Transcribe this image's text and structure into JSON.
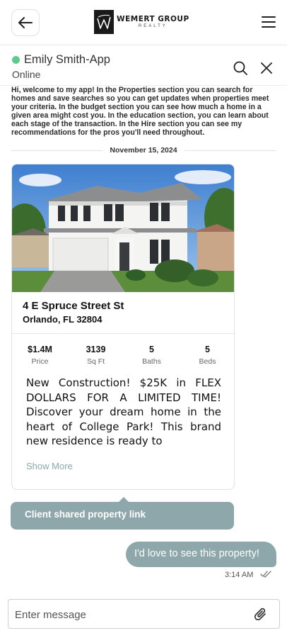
{
  "header": {
    "brand_name": "WEMERT GROUP",
    "brand_sub": "REALTY",
    "icons": [
      "back-arrow-icon",
      "logo-icon",
      "hamburger-menu-icon"
    ]
  },
  "chat": {
    "contact_name": "Emily Smith-App",
    "contact_status": "Online",
    "status_color": "#5fca8e",
    "icons": [
      "search-icon",
      "close-icon"
    ]
  },
  "messages": {
    "welcome": "Hi, welcome to my app! In the Properties section you can search for homes and save searches so you can get updates when properties meet your criteria. In the budget section you can see how much a home in a given area might cost you. In the education section, you can learn about each stage of the transaction. In the Hire section you can see my recommendations for the pros you'll need throughout.",
    "date": "November 15, 2024",
    "property": {
      "address_line1": "4 E Spruce Street St",
      "address_line2": "Orlando, FL 32804",
      "stats": [
        {
          "value": "$1.4M",
          "label": "Price"
        },
        {
          "value": "3139",
          "label": "Sq Ft"
        },
        {
          "value": "5",
          "label": "Baths"
        },
        {
          "value": "5",
          "label": "Beds"
        }
      ],
      "description": "New Construction! $25K in FLEX DOLLARS FOR A LIMITED TIME! Discover your dream home in the heart of College Park! This brand new residence is ready to",
      "show_more": "Show More"
    },
    "shared_label": "Client shared property link",
    "outgoing": {
      "text": "I'd love to see this property!",
      "time": "3:14 AM"
    }
  },
  "composer": {
    "placeholder": "Enter message",
    "icons": [
      "paperclip-icon"
    ]
  },
  "colors": {
    "accent": "#8ea7ab",
    "online": "#5fca8e",
    "link": "#8aa7ae"
  }
}
